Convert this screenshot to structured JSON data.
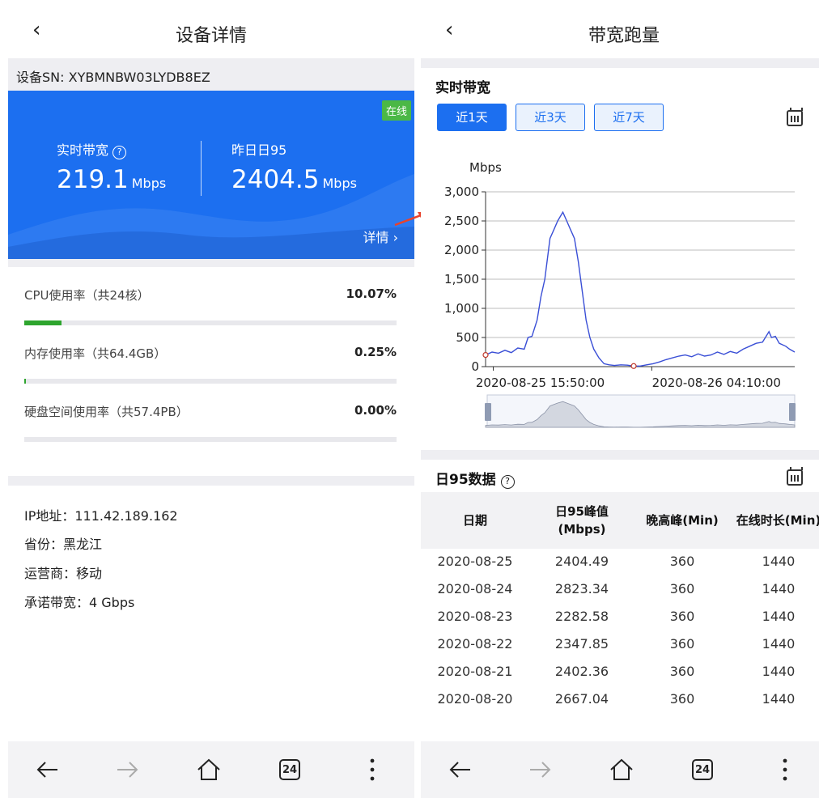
{
  "left": {
    "title": "设备详情",
    "back": "‹",
    "sn": "设备SN: XYBMNBW03LYDB8EZ",
    "badge": "在线",
    "realtime_label": "实时带宽",
    "realtime_value": "219.1",
    "yesterday_label": "昨日日95",
    "yesterday_value": "2404.5",
    "unit": "Mbps",
    "detail": "详情",
    "resources": [
      {
        "label": "CPU使用率（共24核）",
        "value": "10.07%",
        "fill": 0.1007
      },
      {
        "label": "内存使用率（共64.4GB）",
        "value": "0.25%",
        "fill": 0.0025
      },
      {
        "label": "硬盘空间使用率（共57.4PB）",
        "value": "0.00%",
        "fill": 0.0
      }
    ],
    "info": [
      "IP地址：111.42.189.162",
      "省份：黑龙江",
      "运营商：移动",
      "承诺带宽：4 Gbps"
    ]
  },
  "right": {
    "title": "带宽跑量",
    "back": "‹",
    "realtime_title": "实时带宽",
    "ranges": [
      "近1天",
      "近3天",
      "近7天"
    ],
    "active_range": 0,
    "day95_title": "日95数据",
    "table": {
      "headers": [
        "日期",
        "日95峰值\n(Mbps)",
        "晚高峰(Min)",
        "在线时长(Min)"
      ],
      "rows": [
        [
          "2020-08-25",
          "2404.49",
          "360",
          "1440"
        ],
        [
          "2020-08-24",
          "2823.34",
          "360",
          "1440"
        ],
        [
          "2020-08-23",
          "2282.58",
          "360",
          "1440"
        ],
        [
          "2020-08-22",
          "2347.85",
          "360",
          "1440"
        ],
        [
          "2020-08-21",
          "2402.36",
          "360",
          "1440"
        ],
        [
          "2020-08-20",
          "2667.04",
          "360",
          "1440"
        ]
      ]
    }
  },
  "nav": {
    "tab_count": "24"
  },
  "colors": {
    "primary": "#1c6ff0",
    "online": "#4bb846",
    "progress": "#2ea52e",
    "line": "#3a4fd6"
  },
  "chart_data": {
    "type": "line",
    "ylabel": "Mbps",
    "ylim": [
      0,
      3000
    ],
    "yticks": [
      "0",
      "500",
      "1,000",
      "1,500",
      "2,000",
      "2,500",
      "3,000"
    ],
    "xtick_labels": [
      "2020-08-25 15:50:00",
      "2020-08-26 04:10:00"
    ],
    "x_range_hours": [
      0,
      24
    ],
    "xtick_positions_hours": [
      0.6,
      12.9
    ],
    "grid": true,
    "series": [
      {
        "name": "",
        "x": [
          0,
          0.5,
          1,
          1.5,
          2,
          2.5,
          3,
          3.3,
          3.6,
          4,
          4.3,
          4.6,
          5,
          5.3,
          5.6,
          6,
          6.3,
          6.6,
          6.9,
          7.2,
          7.5,
          7.8,
          8.1,
          8.4,
          8.8,
          9.2,
          9.6,
          10,
          10.5,
          11,
          11.5,
          12,
          12.5,
          13,
          13.5,
          14,
          14.5,
          15,
          15.5,
          16,
          16.5,
          17,
          17.5,
          18,
          18.5,
          19,
          19.5,
          20,
          20.5,
          21,
          21.5,
          22,
          22.2,
          22.5,
          22.8,
          23,
          23.3,
          23.6,
          24
        ],
        "y": [
          200,
          250,
          230,
          280,
          240,
          320,
          300,
          500,
          520,
          800,
          1200,
          1500,
          2200,
          2350,
          2500,
          2650,
          2500,
          2350,
          2200,
          1800,
          1300,
          800,
          500,
          300,
          150,
          50,
          30,
          20,
          30,
          25,
          10,
          10,
          30,
          50,
          80,
          120,
          150,
          180,
          200,
          170,
          220,
          180,
          200,
          250,
          210,
          260,
          230,
          300,
          350,
          400,
          420,
          600,
          500,
          520,
          400,
          380,
          350,
          300,
          250
        ]
      }
    ]
  }
}
